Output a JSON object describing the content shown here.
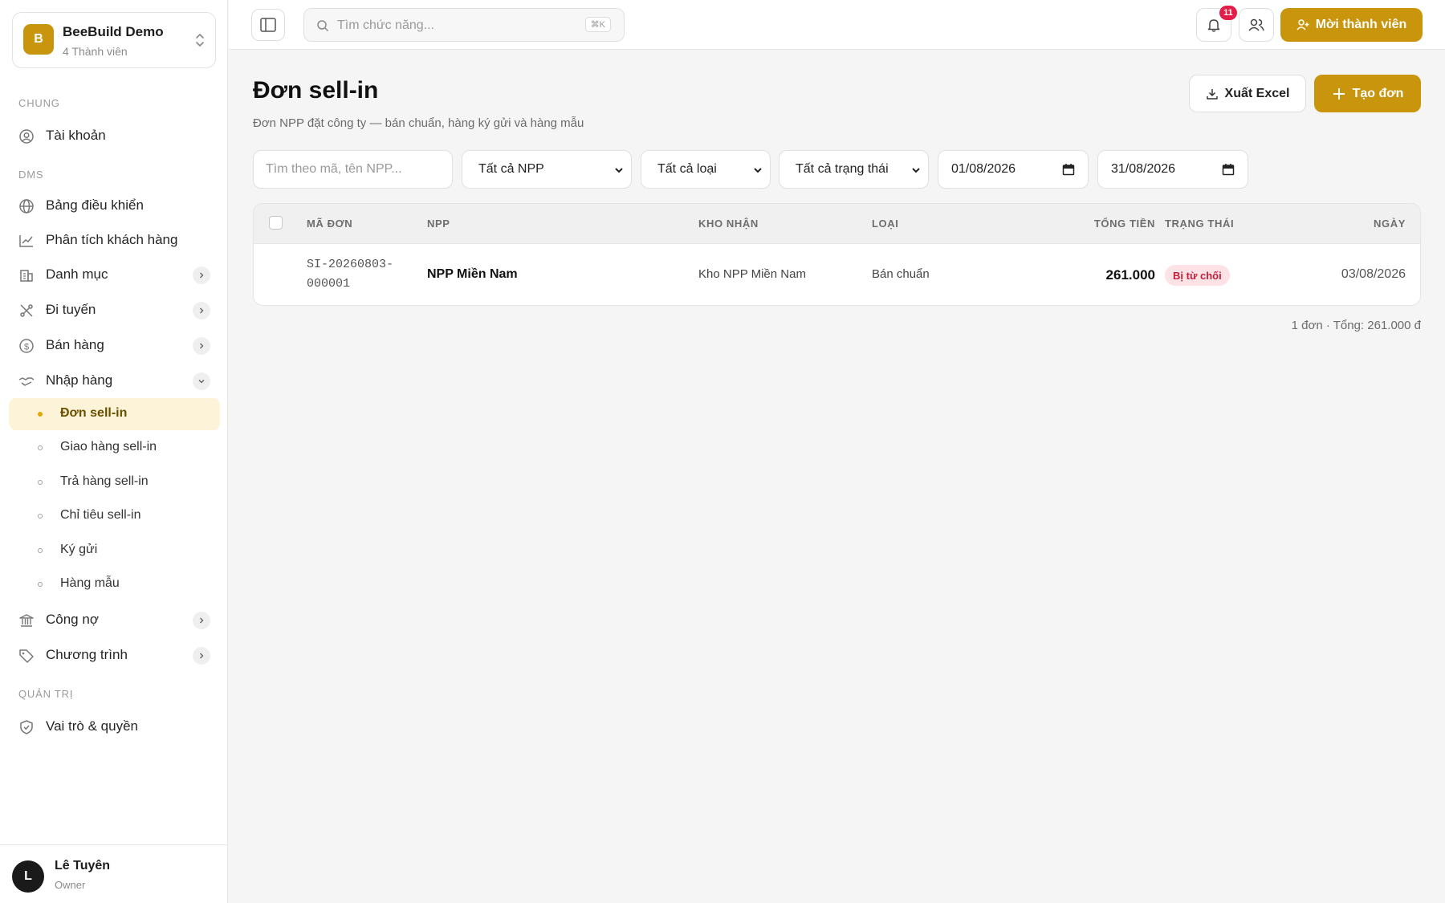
{
  "org": {
    "logo_letter": "B",
    "name": "BeeBuild Demo",
    "members": "4 Thành viên"
  },
  "sidebar": {
    "sections": {
      "general": "CHUNG",
      "dms": "DMS",
      "admin": "QUẢN TRỊ"
    },
    "account": "Tài khoản",
    "items": [
      {
        "label": "Bảng điều khiển",
        "icon": "globe-icon"
      },
      {
        "label": "Phân tích khách hàng",
        "icon": "chart-line-icon"
      },
      {
        "label": "Danh mục",
        "icon": "building-icon"
      },
      {
        "label": "Đi tuyến",
        "icon": "route-icon"
      },
      {
        "label": "Bán hàng",
        "icon": "dollar-icon"
      },
      {
        "label": "Nhập hàng",
        "icon": "handshake-icon"
      },
      {
        "label": "Công nợ",
        "icon": "bank-icon"
      },
      {
        "label": "Chương trình",
        "icon": "tag-icon"
      }
    ],
    "sub_items": [
      "Đơn sell-in",
      "Giao hàng sell-in",
      "Trả hàng sell-in",
      "Chỉ tiêu sell-in",
      "Ký gửi",
      "Hàng mẫu"
    ],
    "roles": "Vai trò & quyền"
  },
  "user": {
    "initial": "L",
    "name": "Lê Tuyên",
    "role": "Owner"
  },
  "topbar": {
    "search_placeholder": "Tìm chức năng...",
    "shortcut": "⌘K",
    "notifications": "11",
    "invite_label": "Mời thành viên"
  },
  "page": {
    "title": "Đơn sell-in",
    "subtitle": "Đơn NPP đặt công ty — bán chuẩn, hàng ký gửi và hàng mẫu",
    "export_label": "Xuất Excel",
    "create_label": "Tạo đơn"
  },
  "filters": {
    "search_placeholder": "Tìm theo mã, tên NPP...",
    "npp": "Tất cả NPP",
    "type": "Tất cả loại",
    "status": "Tất cả trạng thái",
    "date_from": "01/08/2026",
    "date_to": "31/08/2026"
  },
  "table": {
    "headers": [
      "MÃ ĐƠN",
      "NPP",
      "KHO NHẬN",
      "LOẠI",
      "TỔNG TIỀN",
      "TRẠNG THÁI",
      "NGÀY"
    ],
    "rows": [
      {
        "code_line1": "SI-20260803-",
        "code_line2": "000001",
        "npp": "NPP Miền Nam",
        "warehouse": "Kho NPP Miền Nam",
        "type": "Bán chuẩn",
        "total": "261.000",
        "status": "Bị từ chối",
        "date": "03/08/2026"
      }
    ]
  },
  "summary": "1 đơn · Tổng: 261.000 đ",
  "colors": {
    "accent": "#c9950c",
    "active_bg": "#fdf3d8",
    "danger": "#e11d48",
    "status_bg": "#fde2e6"
  }
}
